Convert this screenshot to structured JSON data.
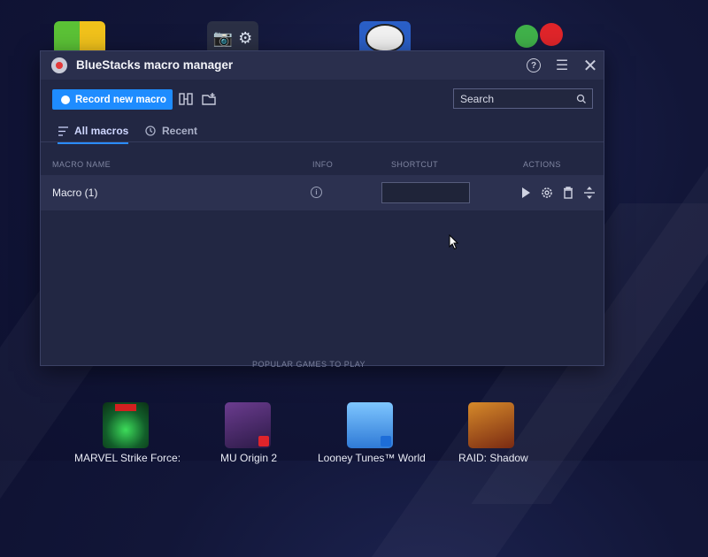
{
  "window": {
    "title": "BlueStacks macro manager"
  },
  "toolbar": {
    "record_label": "Record new macro",
    "search": {
      "placeholder": "Search",
      "value": ""
    }
  },
  "tabs": [
    {
      "label": "All macros",
      "active": true
    },
    {
      "label": "Recent",
      "active": false
    }
  ],
  "table": {
    "columns": [
      "MACRO NAME",
      "INFO",
      "SHORTCUT",
      "ACTIONS"
    ],
    "rows": [
      {
        "name": "Macro (1)",
        "shortcut": ""
      }
    ]
  },
  "background": {
    "popular_games_caption": "POPULAR GAMES TO PLAY",
    "games": [
      {
        "label": "MARVEL Strike Force:"
      },
      {
        "label": "MU Origin 2"
      },
      {
        "label": "Looney Tunes™ World"
      },
      {
        "label": "RAID: Shadow"
      }
    ]
  },
  "colors": {
    "accent": "#1e8cff",
    "window_bg": "#222743",
    "titlebar_bg": "#2a2f4d"
  },
  "icons": [
    "help-icon",
    "menu-icon",
    "close-icon",
    "merge-icon",
    "import-icon",
    "search-icon",
    "list-icon",
    "history-icon",
    "info-icon",
    "play-icon",
    "settings-icon",
    "delete-icon",
    "move-icon"
  ]
}
